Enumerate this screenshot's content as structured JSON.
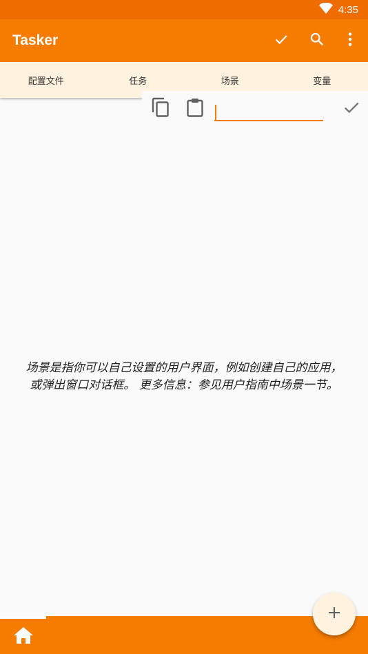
{
  "status_bar": {
    "time": "4:35"
  },
  "app_bar": {
    "title": "Tasker"
  },
  "tabs": [
    {
      "label": "配置文件"
    },
    {
      "label": "任务"
    },
    {
      "label": "场景"
    },
    {
      "label": "变量"
    }
  ],
  "name_input": {
    "value": "",
    "placeholder": ""
  },
  "info": {
    "line1": "场景是指你可以自己设置的用户界面，例如创建自己的应用，",
    "line2": "或弹出窗口对话框。 更多信息：参见用户指南中场景一节。"
  },
  "icons": {
    "wifi": "wifi-icon",
    "check": "check-icon",
    "search": "search-icon",
    "more": "more-vert-icon",
    "copy": "copy-icon",
    "paste": "clipboard-icon",
    "home": "home-icon",
    "add": "add-icon"
  },
  "colors": {
    "status_bar": "#ef6c00",
    "primary": "#f57c00",
    "tab_bar": "#fff3e0",
    "background": "#fafafa",
    "fab": "#fff3e0"
  }
}
